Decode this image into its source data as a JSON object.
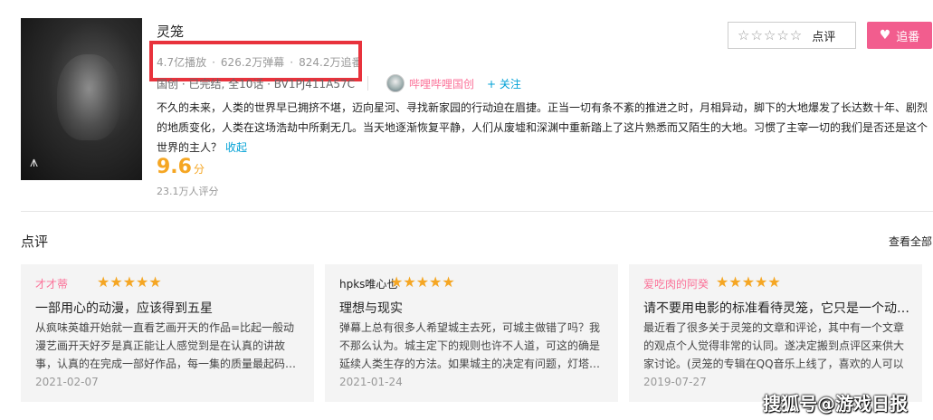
{
  "anime": {
    "title": "灵笼",
    "stats": {
      "plays": "4.7亿播放",
      "danmaku": "626.2万弹幕",
      "follows": "824.2万追番"
    },
    "meta_text": "国创 · 已完结, 全10话 · BV1PJ411A57C",
    "uploader": "哔哩哔哩国创",
    "follow_label": "+ 关注",
    "description": "不久的未来，人类的世界早已拥挤不堪，迈向星河、寻找新家园的行动迫在眉捷。正当一切有条不紊的推进之时，月相异动，脚下的大地爆发了长达数十年、剧烈的地质变化，人类在这场浩劫中所剩无几。当天地逐渐恢复平静，人们从废墟和深渊中重新踏上了这片熟悉而又陌生的大地。习惯了主宰一切的我们是否还是这个世界的主人？",
    "collapse_label": "收起",
    "score": "9.6",
    "score_unit": "分",
    "ratings_count": "23.1万人评分"
  },
  "actions": {
    "rate_label": "点评",
    "rate_stars": "☆☆☆☆☆",
    "follow_button": "追番"
  },
  "reviews_section": {
    "title": "点评",
    "see_all": "查看全部",
    "cards": [
      {
        "user": "才才蒂",
        "stars": "★★★★★",
        "title": "一部用心的动漫，应该得到五星",
        "body": "从疯味英雄开始就一直看艺画开天的作品=比起一般动漫艺画开天好歹是真正能让人感觉到是在认真的讲故事，认真的在完成一部好作品，每一集的质量最起码…",
        "date": "2021-02-07"
      },
      {
        "user": "hpks唯心也",
        "stars": "★★★★★",
        "title": "理想与现实",
        "body": "弹幕上总有很多人希望城主去死，可城主做错了吗？我不那么认为。城主定下的规则也许不人道，可这的确是延续人类生存的方法。如果城主的决定有问题，灯塔…",
        "date": "2021-01-24"
      },
      {
        "user": "爱吃肉的阿癸",
        "stars": "★★★★★",
        "title": "请不要用电影的标准看待灵笼，它只是一个动…",
        "body": "最近看了很多关于灵笼的文章和评论，其中有一个文章的观点个人觉得非常的认同。遂决定搬到点评区来供大家讨论。(灵笼的专辑在QQ音乐上线了，喜欢的人可以买一…",
        "date": "2019-07-27"
      }
    ]
  },
  "watermark": "搜狐号@游戏日报",
  "colors": {
    "accent_pink": "#fb7299",
    "follow_btn": "#f25d8e",
    "highlight_red": "#e8323c",
    "score_orange": "#f5a623",
    "link_blue": "#00a1d6"
  }
}
